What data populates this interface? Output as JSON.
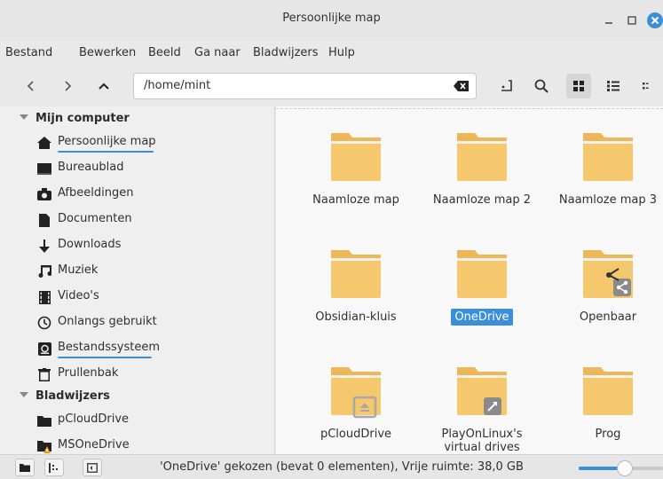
{
  "window": {
    "title": "Persoonlijke map"
  },
  "menu": [
    "Bestand",
    "Bewerken",
    "Beeld",
    "Ga naar",
    "Bladwijzers",
    "Hulp"
  ],
  "toolbar": {
    "location": "/home/mint"
  },
  "sidebar": {
    "computer_header": "Mijn computer",
    "items": [
      {
        "label": "Persoonlijke map",
        "icon": "home-icon"
      },
      {
        "label": "Bureaublad",
        "icon": "desktop-icon"
      },
      {
        "label": "Afbeeldingen",
        "icon": "camera-icon"
      },
      {
        "label": "Documenten",
        "icon": "document-icon"
      },
      {
        "label": "Downloads",
        "icon": "download-icon"
      },
      {
        "label": "Muziek",
        "icon": "music-icon"
      },
      {
        "label": "Video's",
        "icon": "video-icon"
      },
      {
        "label": "Onlangs gebruikt",
        "icon": "clock-icon"
      },
      {
        "label": "Bestandssysteem",
        "icon": "drive-icon"
      },
      {
        "label": "Prullenbak",
        "icon": "trash-icon"
      }
    ],
    "bookmarks_header": "Bladwijzers",
    "bookmarks": [
      {
        "label": "pCloudDrive",
        "icon": "folder-icon"
      },
      {
        "label": "MSOneDrive",
        "icon": "folder-warning-icon"
      }
    ]
  },
  "files": [
    {
      "name": "Naamloze map",
      "emblem": "none"
    },
    {
      "name": "Naamloze map 2",
      "emblem": "none"
    },
    {
      "name": "Naamloze map 3",
      "emblem": "none"
    },
    {
      "name": "Obsidian-kluis",
      "emblem": "none"
    },
    {
      "name": "OneDrive",
      "emblem": "none",
      "selected": true
    },
    {
      "name": "Openbaar",
      "emblem": "share"
    },
    {
      "name": "pCloudDrive",
      "emblem": "eject"
    },
    {
      "name": "PlayOnLinux's",
      "name2": "virtual drives",
      "emblem": "symlink"
    },
    {
      "name": "Prog",
      "emblem": "none"
    }
  ],
  "status": {
    "text": "'OneDrive' gekozen (bevat 0 elementen), Vrije ruimte: 38,0 GB",
    "zoom_level": 0.55
  },
  "colors": {
    "accent": "#3b8fd9",
    "folder": "#f6c86d",
    "folder_tab": "#edb656",
    "close": "#3b8fd9"
  }
}
